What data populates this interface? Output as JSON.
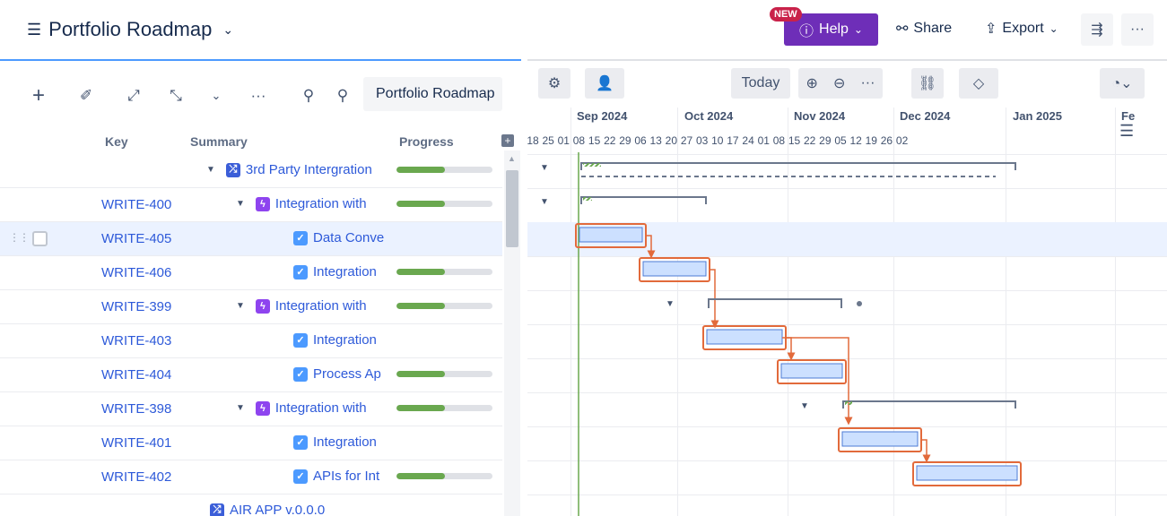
{
  "header": {
    "title": "Portfolio Roadmap",
    "new_badge": "NEW",
    "help_label": "Help",
    "share_label": "Share",
    "export_label": "Export"
  },
  "toolbar": {
    "roadmap_name": "Portfolio Roadmap"
  },
  "columns": {
    "key": "Key",
    "summary": "Summary",
    "progress": "Progress"
  },
  "rows": [
    {
      "key": "",
      "summary": "3rd Party Intergration",
      "icon": "shuffle-icon",
      "expander": true,
      "progress": 0.5
    },
    {
      "key": "WRITE-400",
      "summary": "Integration with",
      "icon": "epic-icon",
      "expander": true,
      "progress": 0.5
    },
    {
      "key": "WRITE-405",
      "summary": "Data Conve",
      "icon": "task-icon",
      "expander": false,
      "progress": null
    },
    {
      "key": "WRITE-406",
      "summary": "Integration",
      "icon": "task-icon",
      "expander": false,
      "progress": 0.5
    },
    {
      "key": "WRITE-399",
      "summary": "Integration with",
      "icon": "epic-icon",
      "expander": true,
      "progress": 0.5
    },
    {
      "key": "WRITE-403",
      "summary": "Integration",
      "icon": "task-icon",
      "expander": false,
      "progress": null
    },
    {
      "key": "WRITE-404",
      "summary": "Process Ap",
      "icon": "task-icon",
      "expander": false,
      "progress": 0.5
    },
    {
      "key": "WRITE-398",
      "summary": "Integration with",
      "icon": "epic-icon",
      "expander": true,
      "progress": 0.5
    },
    {
      "key": "WRITE-401",
      "summary": "Integration",
      "icon": "task-icon",
      "expander": false,
      "progress": null
    },
    {
      "key": "WRITE-402",
      "summary": "APIs for Int",
      "icon": "task-icon",
      "expander": false,
      "progress": 0.5
    },
    {
      "key": "",
      "summary": "AIR APP v.0.0.0",
      "icon": "shuffle-icon",
      "expander": false,
      "progress": null
    }
  ],
  "timeline": {
    "today_label": "Today",
    "months": [
      "Sep 2024",
      "Oct 2024",
      "Nov 2024",
      "Dec 2024",
      "Jan 2025",
      "Fe"
    ],
    "days": [
      "18",
      "25",
      "01",
      "08",
      "15",
      "22",
      "29",
      "06",
      "13",
      "20",
      "27",
      "03",
      "10",
      "17",
      "24",
      "01",
      "08",
      "15",
      "22",
      "29",
      "05",
      "12",
      "19",
      "26",
      "02"
    ]
  },
  "colors": {
    "accent": "#6e2eb8",
    "link": "#2e5ad9",
    "progress": "#6aa84f",
    "today_line": "#6aa84f",
    "dependency": "#e26a3b",
    "task_bar": "#cce0ff"
  }
}
